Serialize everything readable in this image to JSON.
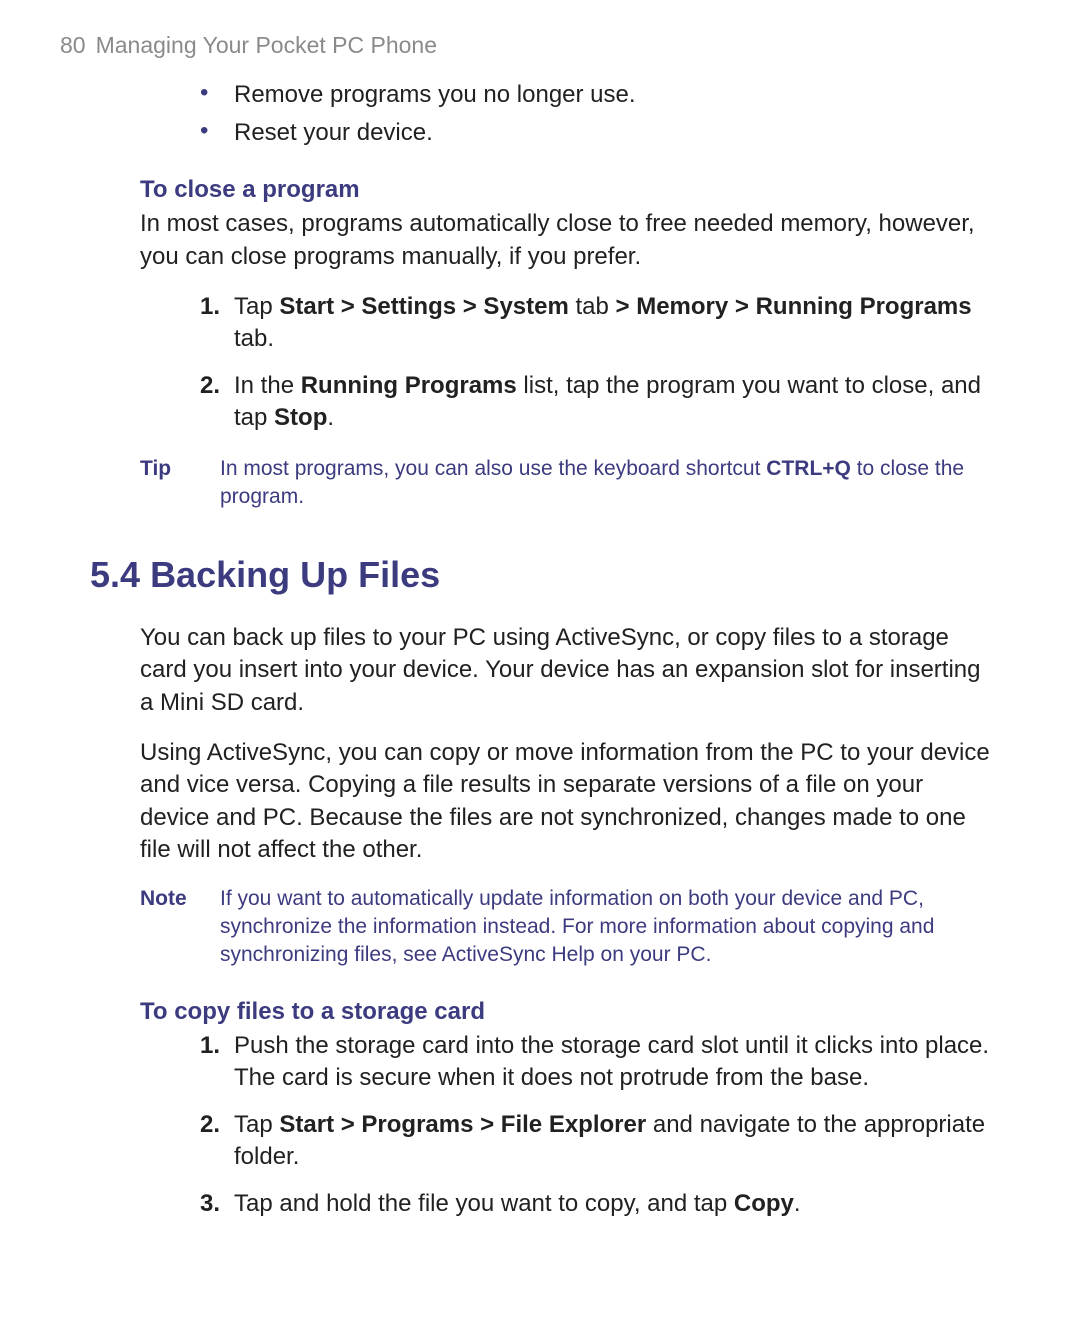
{
  "header": {
    "page_number": "80",
    "chapter_title": "Managing Your Pocket PC Phone"
  },
  "bullets_top": [
    "Remove programs you no longer use.",
    "Reset your device."
  ],
  "close_program": {
    "heading": "To close a program",
    "intro": "In most cases, programs automatically close to free needed memory, however, you can close programs manually, if you prefer.",
    "steps": {
      "s1": {
        "p1": "Tap ",
        "b1": "Start > Settings > System",
        "p2": " tab ",
        "b2": "> Memory > Running Programs",
        "p3": " tab."
      },
      "s2": {
        "p1": "In the ",
        "b1": "Running Programs",
        "p2": " list, tap the program you want to close, and tap ",
        "b2": "Stop",
        "p3": "."
      }
    }
  },
  "tip": {
    "label": "Tip",
    "t1": "In most programs, you can also use the keyboard shortcut ",
    "b1": "CTRL+Q",
    "t2": " to close the program."
  },
  "section_54": {
    "num": "5.4",
    "title": "Backing Up Files",
    "p1": "You can back up files to your PC using ActiveSync, or copy files to a storage card you insert into your device. Your device has an expansion slot for inserting a Mini SD card.",
    "p2": "Using ActiveSync, you can copy or move information from the PC to your device and vice versa. Copying a file results in separate versions of a file on your device and PC. Because the files are not synchronized, changes made to one file will not affect the other."
  },
  "note": {
    "label": "Note",
    "text": "If you want to automatically update information on both your device and PC, synchronize the information instead. For more information about copying and synchronizing files, see ActiveSync Help on your PC."
  },
  "copy_card": {
    "heading": "To copy files to a storage card",
    "steps": {
      "s1": {
        "text": "Push the storage card into the storage card slot until it clicks into place. The card is secure when it does not protrude from the base."
      },
      "s2": {
        "p1": "Tap ",
        "b1": "Start > Programs > File Explorer",
        "p2": " and navigate to the appropriate folder."
      },
      "s3": {
        "p1": "Tap and hold the file you want to copy, and tap ",
        "b1": "Copy",
        "p2": "."
      }
    }
  }
}
